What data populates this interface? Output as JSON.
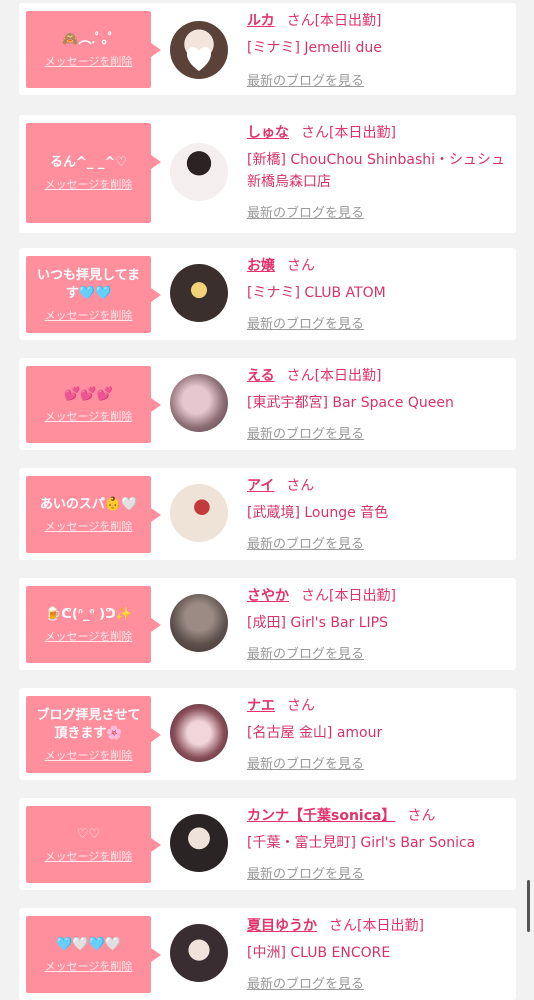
{
  "entries": [
    {
      "message": "🙈︵.ﾟ｡ﾟ",
      "delete_label": "メッセージを削除",
      "name": "ルカ",
      "honorific": "さん",
      "status": "[本日出勤]",
      "shop": "[ミナミ] Jemelli due",
      "blog_label": "最新のブログを見る"
    },
    {
      "message": "るん^_ _^♡",
      "delete_label": "メッセージを削除",
      "name": "しゅな",
      "honorific": "さん",
      "status": "[本日出勤]",
      "shop": "[新橋] ChouChou Shinbashi・シュシュ新橋烏森口店",
      "blog_label": "最新のブログを見る"
    },
    {
      "message": "いつも拝見してます🩵🩵",
      "delete_label": "メッセージを削除",
      "name": "お嬢",
      "honorific": "さん",
      "status": "",
      "shop": "[ミナミ] CLUB ATOM",
      "blog_label": "最新のブログを見る"
    },
    {
      "message": "💕💕💕",
      "delete_label": "メッセージを削除",
      "name": "える",
      "honorific": "さん",
      "status": "[本日出勤]",
      "shop": "[東武宇都宮] Bar Space Queen",
      "blog_label": "最新のブログを見る"
    },
    {
      "message": "あいのスパ👶🤍",
      "delete_label": "メッセージを削除",
      "name": "アイ",
      "honorific": "さん",
      "status": "",
      "shop": "[武蔵境] Lounge 音色",
      "blog_label": "最新のブログを見る"
    },
    {
      "message": "🍺ᕦ(ᐢ_ᐢ )ᕤ✨",
      "delete_label": "メッセージを削除",
      "name": "さやか",
      "honorific": "さん",
      "status": "[本日出勤]",
      "shop": "[成田] Girl's Bar LIPS",
      "blog_label": "最新のブログを見る"
    },
    {
      "message": "ブログ拝見させて頂きます🌸",
      "delete_label": "メッセージを削除",
      "name": "ナエ",
      "honorific": "さん",
      "status": "",
      "shop": "[名古屋 金山] amour",
      "blog_label": "最新のブログを見る"
    },
    {
      "message": "♡♡",
      "delete_label": "メッセージを削除",
      "name": "カンナ【千葉sonica】",
      "honorific": "さん",
      "status": "",
      "shop": "[千葉・富士見町] Girl's Bar Sonica",
      "blog_label": "最新のブログを見る"
    },
    {
      "message": "🩵🤍🩵🤍",
      "delete_label": "メッセージを削除",
      "name": "夏目ゆうか",
      "honorific": "さん",
      "status": "[本日出勤]",
      "shop": "[中洲] CLUB ENCORE",
      "blog_label": "最新のブログを見る"
    }
  ],
  "colors": {
    "accent_pink": "#ff8f9d",
    "name_pink": "#e2336b",
    "link_gray": "#999999",
    "background": "#f2f2f2"
  }
}
